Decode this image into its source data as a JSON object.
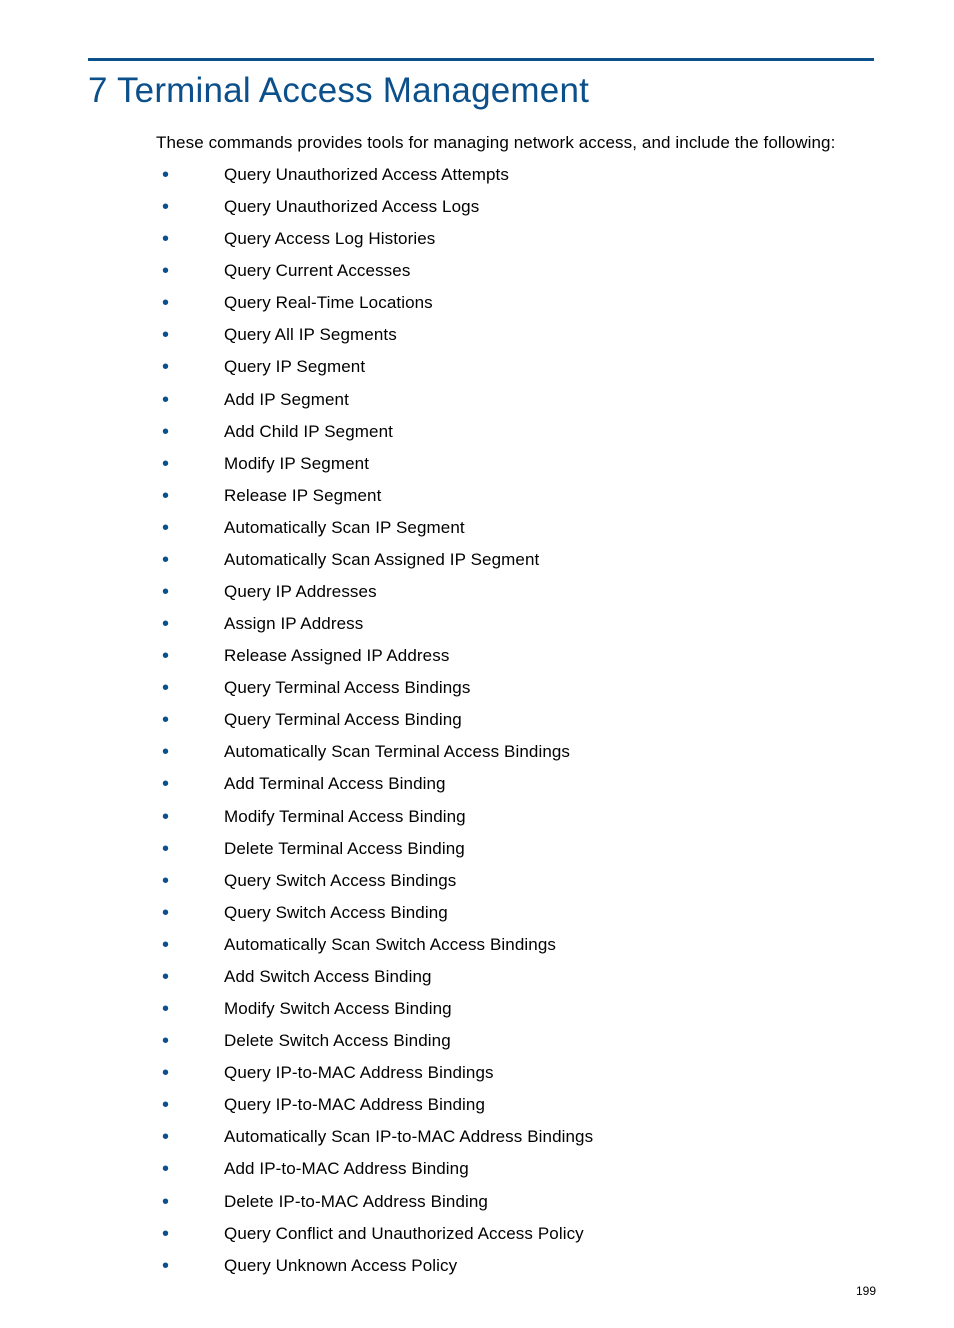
{
  "title": "7 Terminal Access Management",
  "intro": "These commands provides tools for managing network access, and include the following:",
  "items": [
    "Query Unauthorized Access Attempts",
    "Query Unauthorized Access Logs",
    "Query Access Log Histories",
    "Query Current Accesses",
    "Query Real-Time Locations",
    "Query All IP Segments",
    "Query IP Segment",
    "Add IP Segment",
    "Add Child IP Segment",
    "Modify IP Segment",
    "Release IP Segment",
    "Automatically Scan IP Segment",
    "Automatically Scan Assigned IP Segment",
    "Query IP Addresses",
    "Assign IP Address",
    "Release Assigned IP Address",
    "Query Terminal Access Bindings",
    "Query Terminal Access Binding",
    "Automatically Scan Terminal Access Bindings",
    "Add Terminal Access Binding",
    "Modify Terminal Access Binding",
    "Delete Terminal Access Binding",
    "Query Switch Access Bindings",
    "Query Switch Access Binding",
    "Automatically Scan Switch Access Bindings",
    "Add Switch Access Binding",
    "Modify Switch Access Binding",
    "Delete Switch Access Binding",
    "Query IP-to-MAC Address Bindings",
    "Query IP-to-MAC Address Binding",
    "Automatically Scan IP-to-MAC Address Bindings",
    "Add IP-to-MAC Address Binding",
    "Delete IP-to-MAC Address Binding",
    "Query Conflict and Unauthorized Access Policy",
    "Query Unknown Access Policy"
  ],
  "page_number": "199"
}
